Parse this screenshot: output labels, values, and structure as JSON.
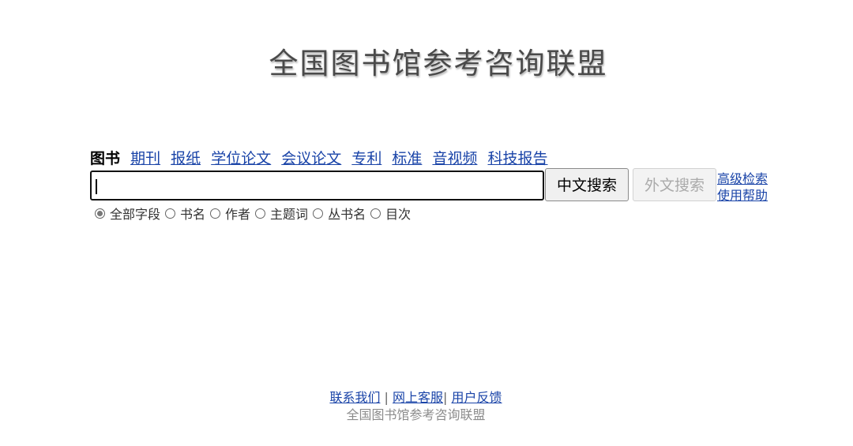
{
  "site": {
    "logo_text": "全国图书馆参考咨询联盟"
  },
  "tabs": [
    {
      "label": "图书",
      "active": true
    },
    {
      "label": "期刊",
      "active": false
    },
    {
      "label": "报纸",
      "active": false
    },
    {
      "label": "学位论文",
      "active": false
    },
    {
      "label": "会议论文",
      "active": false
    },
    {
      "label": "专利",
      "active": false
    },
    {
      "label": "标准",
      "active": false
    },
    {
      "label": "音视频",
      "active": false
    },
    {
      "label": "科技报告",
      "active": false
    }
  ],
  "search": {
    "value": "",
    "cn_button_label": "中文搜索",
    "foreign_button_label": "外文搜索",
    "advanced_label": "高级检索",
    "help_label": "使用帮助"
  },
  "fields": [
    {
      "label": "全部字段",
      "selected": true
    },
    {
      "label": "书名",
      "selected": false
    },
    {
      "label": "作者",
      "selected": false
    },
    {
      "label": "主题词",
      "selected": false
    },
    {
      "label": "丛书名",
      "selected": false
    },
    {
      "label": "目次",
      "selected": false
    }
  ],
  "footer": {
    "links": [
      "联系我们",
      "网上客服",
      "用户反馈"
    ],
    "separator": "|",
    "copyright": "全国图书馆参考咨询联盟"
  },
  "colors": {
    "link": "#1a44a8",
    "logo": "#4a4a4a",
    "disabled_text": "#aaaaaa"
  }
}
